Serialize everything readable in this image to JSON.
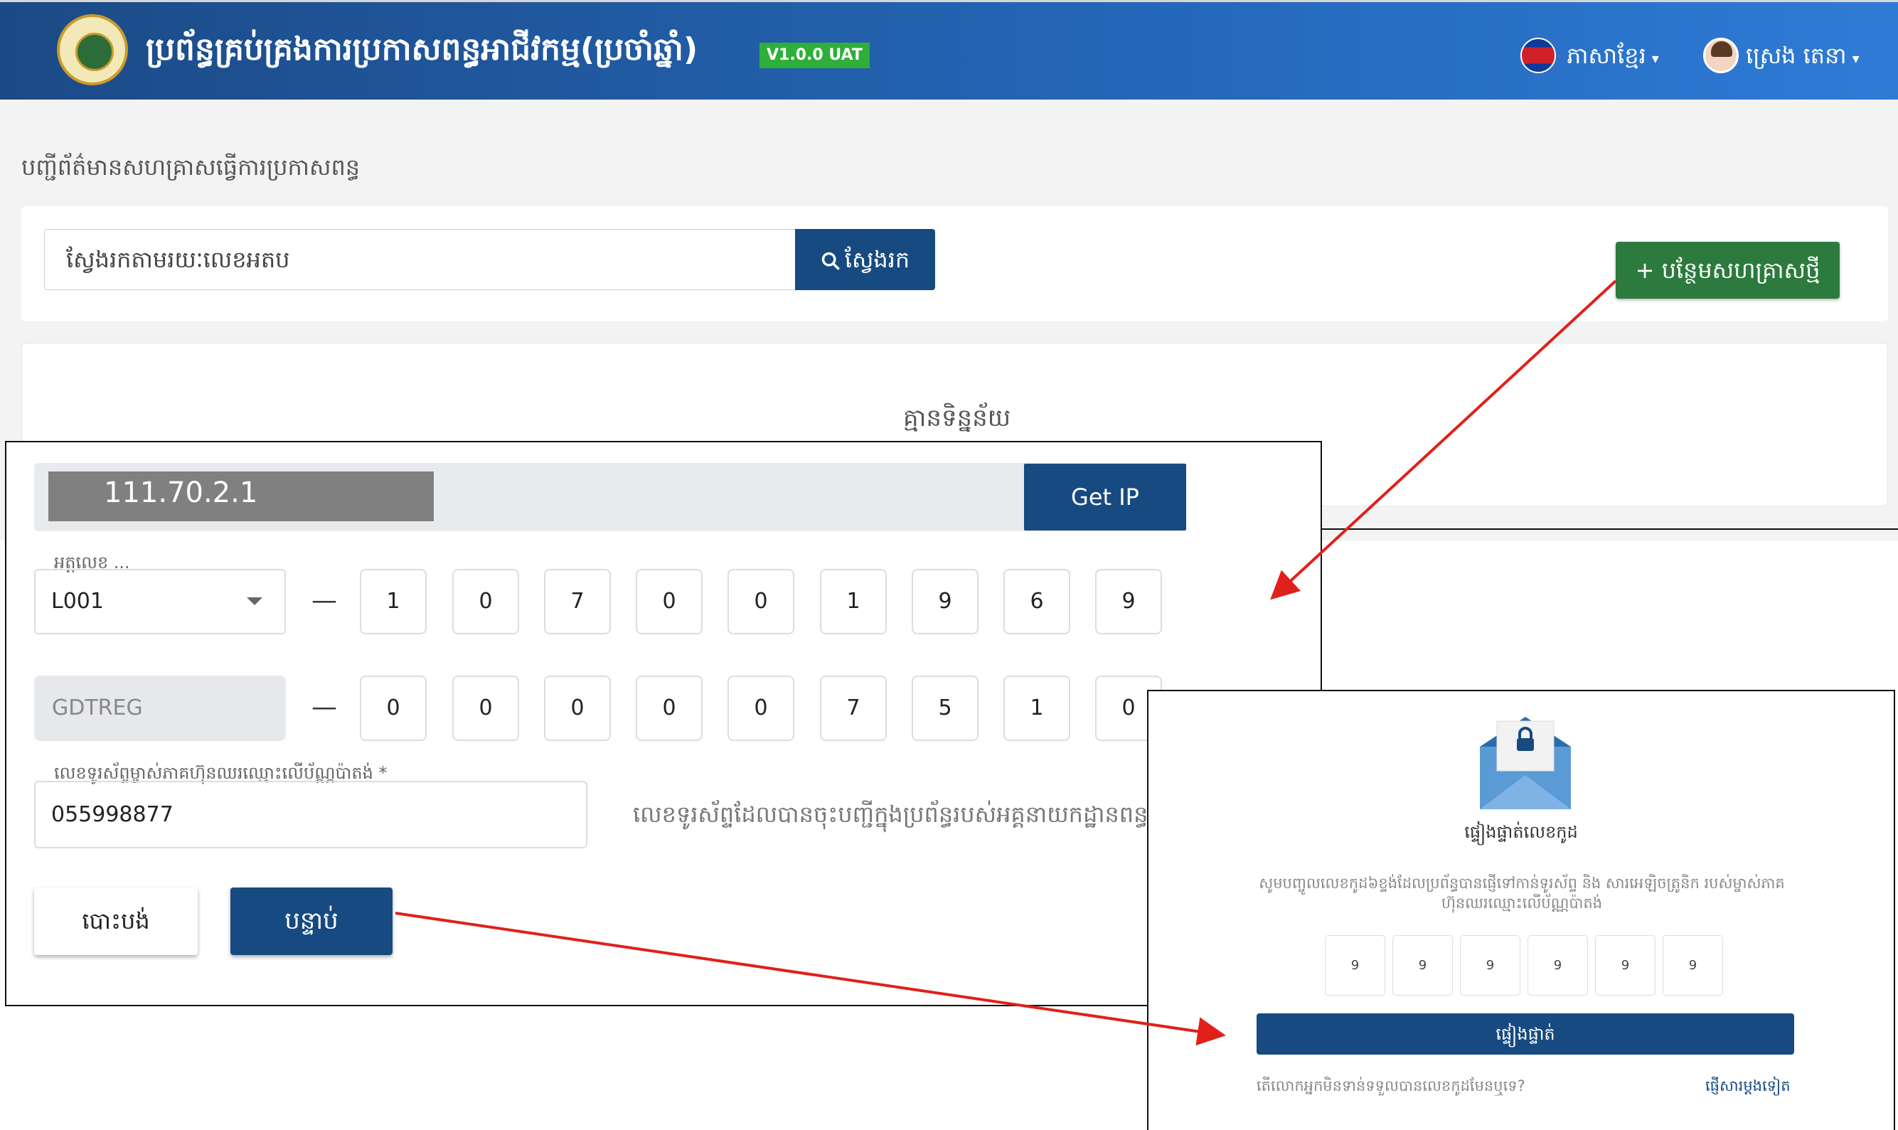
{
  "header": {
    "app_title": "ប្រព័ន្ធគ្រប់គ្រងការប្រកាសពន្ធអាជីវកម្ម(ប្រចាំឆ្នាំ)",
    "version": "V1.0.0 UAT",
    "language": "ភាសាខ្មែរ",
    "user_name": "ស្រេង តេនា",
    "colors": {
      "bar_start": "#1c4a86",
      "bar_end": "#2e7bd6",
      "badge": "#2fae3a"
    }
  },
  "page": {
    "title": "បញ្ជីព័ត៌មានសហគ្រាសធ្វើការប្រកាសពន្ធ",
    "search": {
      "placeholder": "ស្វែងរកតាមរយៈលេខអតប",
      "button_label": "ស្វែងរក"
    },
    "add_button_label": "+ បន្ថែមសហគ្រាសថ្មី",
    "empty_message": "គ្មានទិន្នន័យ"
  },
  "form": {
    "ip_address": "111.70.2.1",
    "get_ip_label": "Get IP",
    "tin_legend": "អត្តលេខ ...",
    "tin_prefix": "L001",
    "tin_digits": [
      "1",
      "0",
      "7",
      "0",
      "0",
      "1",
      "9",
      "6",
      "9"
    ],
    "reg_prefix": "GDTREG",
    "reg_digits": [
      "0",
      "0",
      "0",
      "0",
      "0",
      "7",
      "5",
      "1",
      "0"
    ],
    "phone_legend": "លេខទូរស័ព្ទម្ចាស់ភាគហ៊ុនឈរឈ្មោះលើប័ណ្ណប៉ាតង់ *",
    "phone_value": "055998877",
    "phone_help": "លេខទូរស័ព្ទដែលបានចុះបញ្ជីក្នុងប្រព័ន្ធរបស់អគ្គនាយកដ្ឋានពន្ធ",
    "cancel_label": "បោះបង់",
    "next_label": "បន្ទាប់",
    "dash": "—"
  },
  "otp": {
    "title": "ផ្ទៀងផ្ទាត់លេខកូដ",
    "description": "សូមបញ្ចូលលេខកូដ៦ខ្ទង់ដែលប្រព័ន្ធបានផ្ញើទៅកាន់ទូរស័ព្ទ និង សារអេឡិចត្រូនិក របស់ម្ចាស់ភាគហ៊ុនឈរឈ្មោះលើប័ណ្ណប៉ាតង់",
    "digits": [
      "9",
      "9",
      "9",
      "9",
      "9",
      "9"
    ],
    "verify_label": "ផ្ទៀងផ្ទាត់",
    "question": "តើលោកអ្នកមិនទាន់ទទួលបានលេខកូដមែនឬទេ?",
    "resend_label": "ផ្ញើសារម្តងទៀត"
  },
  "icons": [
    "search-icon",
    "flag-icon",
    "user-avatar-icon",
    "envelope-lock-icon",
    "dropdown-caret-icon"
  ],
  "accent_colors": {
    "primary": "#174a80",
    "success": "#2c7a3e",
    "arrow": "#e0201a"
  }
}
